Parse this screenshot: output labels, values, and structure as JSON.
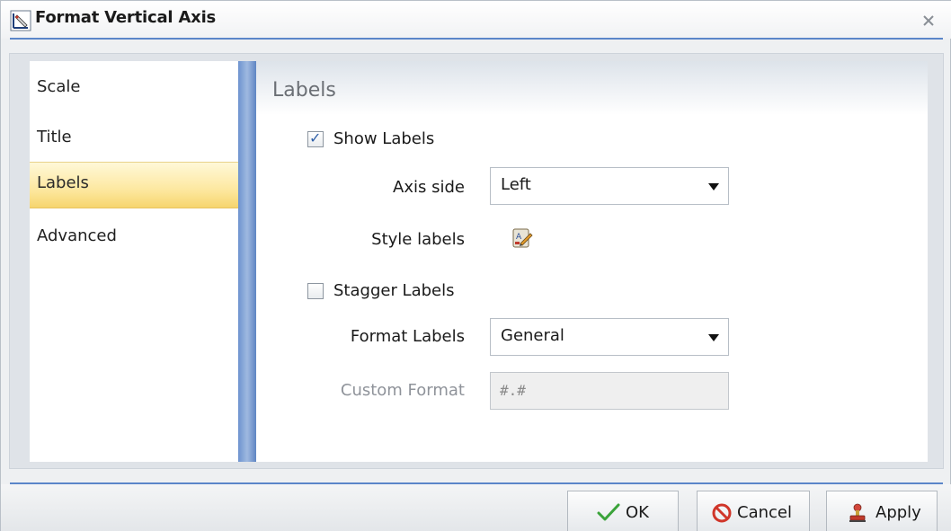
{
  "window": {
    "title": "Format Vertical Axis",
    "icon": "format-axis-icon",
    "close_icon": "close-icon"
  },
  "nav": {
    "items": [
      {
        "label": "Scale",
        "selected": false
      },
      {
        "label": "Title",
        "selected": false
      },
      {
        "label": "Labels",
        "selected": true
      },
      {
        "label": "Advanced",
        "selected": false
      }
    ]
  },
  "panel": {
    "title": "Labels",
    "show_labels": {
      "label": "Show Labels",
      "checked": true
    },
    "axis_side": {
      "label": "Axis side",
      "value": "Left"
    },
    "style_labels": {
      "label": "Style labels",
      "icon": "style-labels-icon"
    },
    "stagger_labels": {
      "label": "Stagger Labels",
      "checked": false
    },
    "format_labels": {
      "label": "Format Labels",
      "value": "General"
    },
    "custom_format": {
      "label": "Custom Format",
      "value": "#.#",
      "disabled": true
    }
  },
  "footer": {
    "ok_label": "OK",
    "cancel_label": "Cancel",
    "apply_label": "Apply"
  },
  "colors": {
    "accent_blue": "#5b86c9",
    "selected_yellow": "#fde8a0",
    "disabled_text": "#8f939a"
  }
}
